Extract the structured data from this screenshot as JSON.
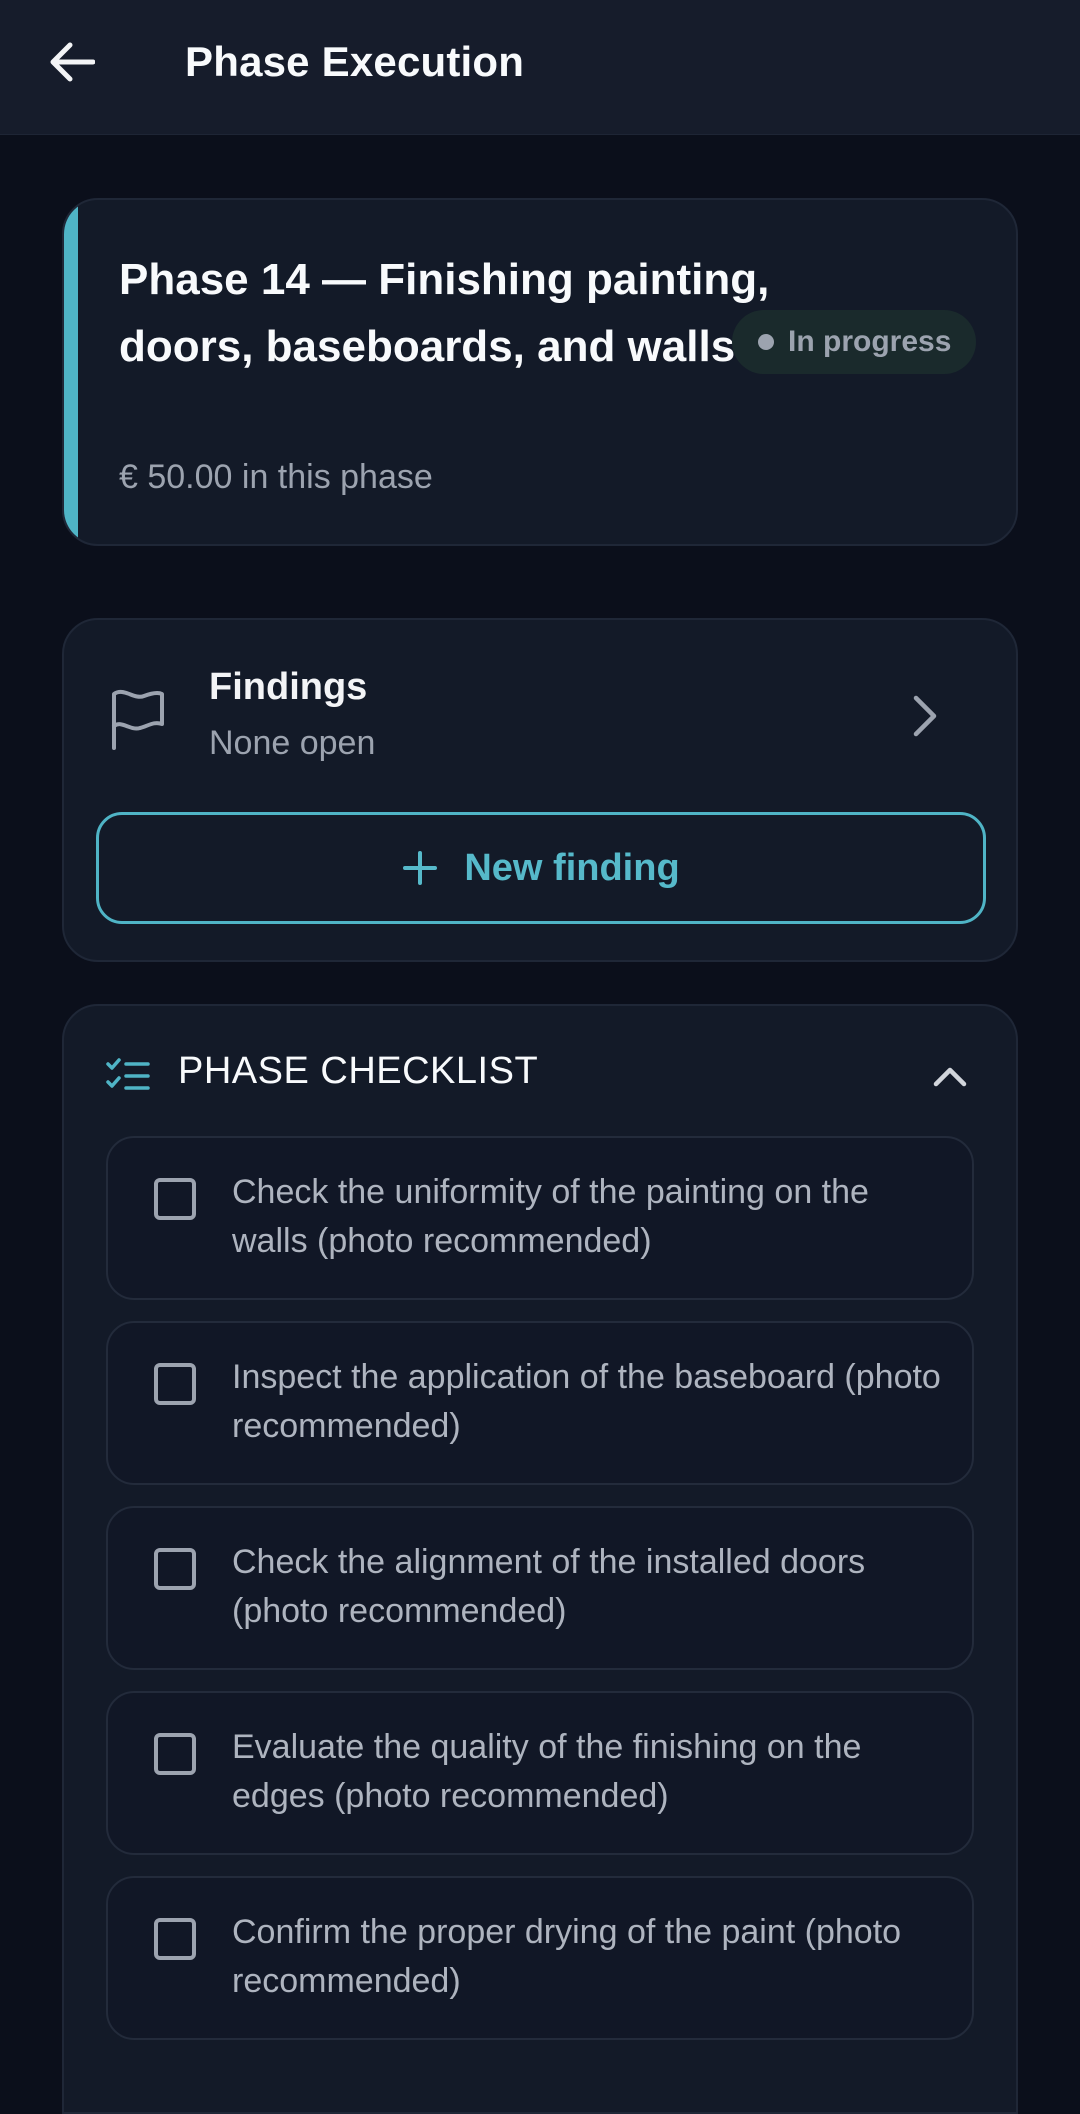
{
  "appbar": {
    "title": "Phase Execution",
    "back_icon": "arrow-left-icon"
  },
  "phase": {
    "title": "Phase 14 — Finishing painting, doors, baseboards, and walls",
    "amount_text": "€ 50.00 in this phase",
    "status": "In progress",
    "accent_color": "#4fb4c6"
  },
  "findings": {
    "title": "Findings",
    "status": "None open",
    "icon": "flag-icon",
    "new_button_label": "New finding"
  },
  "checklist": {
    "title": "PHASE CHECKLIST",
    "icon": "checklist-icon",
    "expanded": true,
    "items": [
      {
        "label": "Check the uniformity of the painting on the walls (photo recommended)",
        "checked": false
      },
      {
        "label": "Inspect the application of the baseboard (photo recommended)",
        "checked": false
      },
      {
        "label": "Check the alignment of the installed doors (photo recommended)",
        "checked": false
      },
      {
        "label": "Evaluate the quality of the finishing on the edges (photo recommended)",
        "checked": false
      },
      {
        "label": "Confirm the proper drying of the paint (photo recommended)",
        "checked": false
      }
    ]
  }
}
